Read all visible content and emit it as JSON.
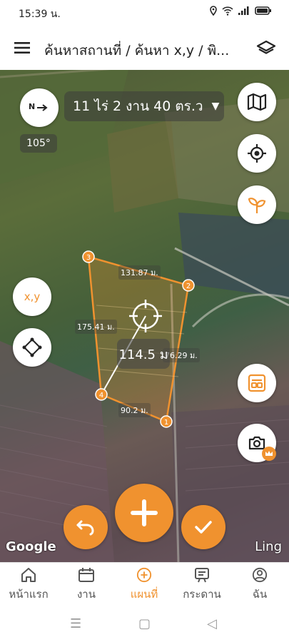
{
  "status": {
    "time": "15:39 น."
  },
  "header": {
    "title": "ค้นหาสถานที่ / ค้นหา x,y / พิ..."
  },
  "map": {
    "area_text": "11 ไร่ 2 งาน 40 ตร.ว",
    "compass_deg": "105°",
    "xy_label": "x,y",
    "edge_labels": {
      "e1": "131.87 ม.",
      "e2": "175.41 ม.",
      "e3": "76.29 ม.",
      "e4": "90.2 ม."
    },
    "vertex_labels": [
      "1",
      "2",
      "3",
      "4"
    ],
    "measure_distance": "114.5 ม",
    "google": "Google",
    "ling": "Ling"
  },
  "nav": [
    {
      "label": "หน้าแรก"
    },
    {
      "label": "งาน"
    },
    {
      "label": "แผนที่"
    },
    {
      "label": "กระดาน"
    },
    {
      "label": "ฉัน"
    }
  ],
  "colors": {
    "accent": "#f0922f"
  }
}
